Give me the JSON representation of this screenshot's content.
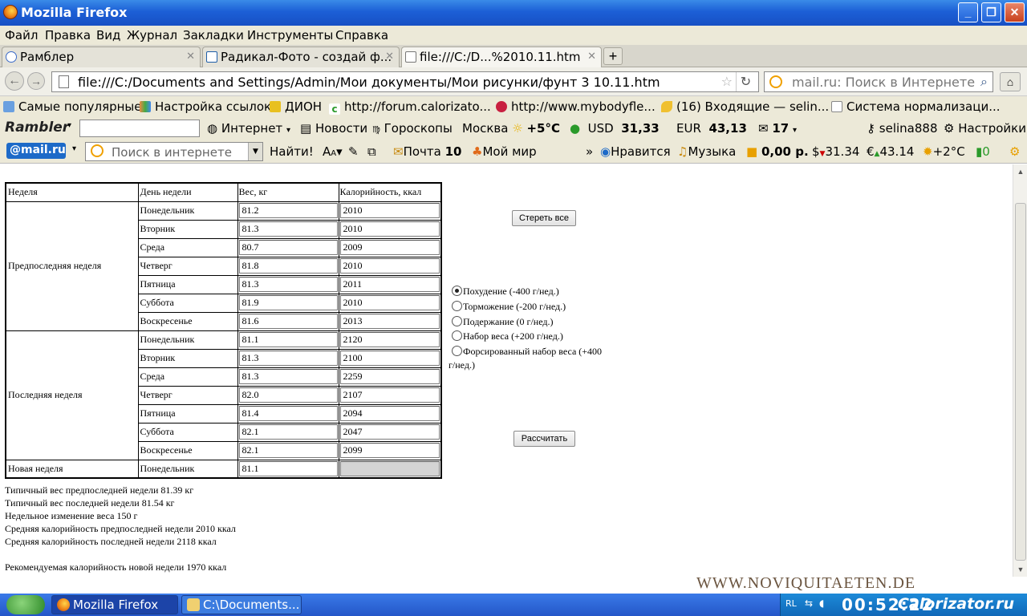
{
  "window": {
    "title": "Mozilla Firefox"
  },
  "menu": [
    "Файл",
    "Правка",
    "Вид",
    "Журнал",
    "Закладки",
    "Инструменты",
    "Справка"
  ],
  "tabs": [
    {
      "label": "Рамблер"
    },
    {
      "label": "Радикал-Фото - создай ф..."
    },
    {
      "label": "file:///C:/D...%2010.11.htm"
    }
  ],
  "nav": {
    "url": "file:///C:/Documents and Settings/Admin/Мои документы/Мои рисунки/фунт 3 10.11.htm",
    "search_placeholder": "mail.ru: Поиск в Интернете"
  },
  "bookmarks": [
    "Самые популярные",
    "Настройка ссылок",
    "ДИОН",
    "http://forum.calorizato...",
    "http://www.mybodyfle...",
    "(16) Входящие — selin...",
    "Система нормализаци..."
  ],
  "rambler": {
    "logo": "Rambler",
    "internet": "Интернет",
    "news": "Новости",
    "horoscope": "Гороскопы",
    "city": "Москва",
    "temp": "+5°C",
    "usd_label": "USD",
    "usd": "31,33",
    "eur_label": "EUR",
    "eur": "43,13",
    "mail_count": "17",
    "user": "selina888",
    "settings": "Настройки"
  },
  "mailru": {
    "logo": "@mail.ru",
    "search_placeholder": "Поиск в интернете",
    "find_label": "Найти!",
    "mail_label": "Почта",
    "mail_count": "10",
    "myworld": "Мой мир",
    "more": "»",
    "like": "Нравится",
    "music": "Музыка",
    "balance": "0,00 р.",
    "usd": "31.34",
    "eur": "43.14",
    "temp": "+2°C",
    "traffic": "0"
  },
  "table": {
    "headers": [
      "Неделя",
      "День недели",
      "Вес, кг",
      "Калорийность, ккал"
    ],
    "week1_label": "Предпоследняя неделя",
    "week2_label": "Последняя неделя",
    "week3_label": "Новая неделя",
    "week1": [
      {
        "day": "Понедельник",
        "weight": "81.2",
        "cal": "2010"
      },
      {
        "day": "Вторник",
        "weight": "81.3",
        "cal": "2010"
      },
      {
        "day": "Среда",
        "weight": "80.7",
        "cal": "2009"
      },
      {
        "day": "Четверг",
        "weight": "81.8",
        "cal": "2010"
      },
      {
        "day": "Пятница",
        "weight": "81.3",
        "cal": "2011"
      },
      {
        "day": "Суббота",
        "weight": "81.9",
        "cal": "2010"
      },
      {
        "day": "Воскресенье",
        "weight": "81.6",
        "cal": "2013"
      }
    ],
    "week2": [
      {
        "day": "Понедельник",
        "weight": "81.1",
        "cal": "2120"
      },
      {
        "day": "Вторник",
        "weight": "81.3",
        "cal": "2100"
      },
      {
        "day": "Среда",
        "weight": "81.3",
        "cal": "2259"
      },
      {
        "day": "Четверг",
        "weight": "82.0",
        "cal": "2107"
      },
      {
        "day": "Пятница",
        "weight": "81.4",
        "cal": "2094"
      },
      {
        "day": "Суббота",
        "weight": "82.1",
        "cal": "2047"
      },
      {
        "day": "Воскресенье",
        "weight": "82.1",
        "cal": "2099"
      }
    ],
    "week3": {
      "day": "Понедельник",
      "weight": "81.1",
      "cal": ""
    }
  },
  "buttons": {
    "clear": "Стереть все",
    "calculate": "Рассчитать"
  },
  "radios": [
    {
      "label": "Похудение (-400 г/нед.)",
      "checked": true
    },
    {
      "label": "Торможение (-200 г/нед.)",
      "checked": false
    },
    {
      "label": "Подержание (0 г/нед.)",
      "checked": false
    },
    {
      "label": "Набор веса (+200 г/нед.)",
      "checked": false
    },
    {
      "label": "Форсированный набор веса (+400",
      "label_cont": "г/нед.)",
      "checked": false
    }
  ],
  "results": [
    "Типичный вес предпоследней недели 81.39 кг",
    "Типичный вес последней недели 81.54 кг",
    "Недельное изменение веса 150 г",
    "Средняя калорийность предпоследней недели 2010 ккал",
    "Средняя калорийность последней недели 2118 ккал",
    "Рекомендуемая калорийность новой недели 1970 ккал"
  ],
  "watermark": "WWW.NOVIQUITAETEN.DE",
  "taskbar": {
    "tasks": [
      "Mozilla Firefox",
      "C:\\Documents..."
    ],
    "lang": "RL",
    "clock": "00:52:22",
    "brand": "Calorizator.ru"
  },
  "colors": {
    "titlebar": "#1c5fd6",
    "chrome": "#ece9d8",
    "taskbar": "#2456c8"
  }
}
